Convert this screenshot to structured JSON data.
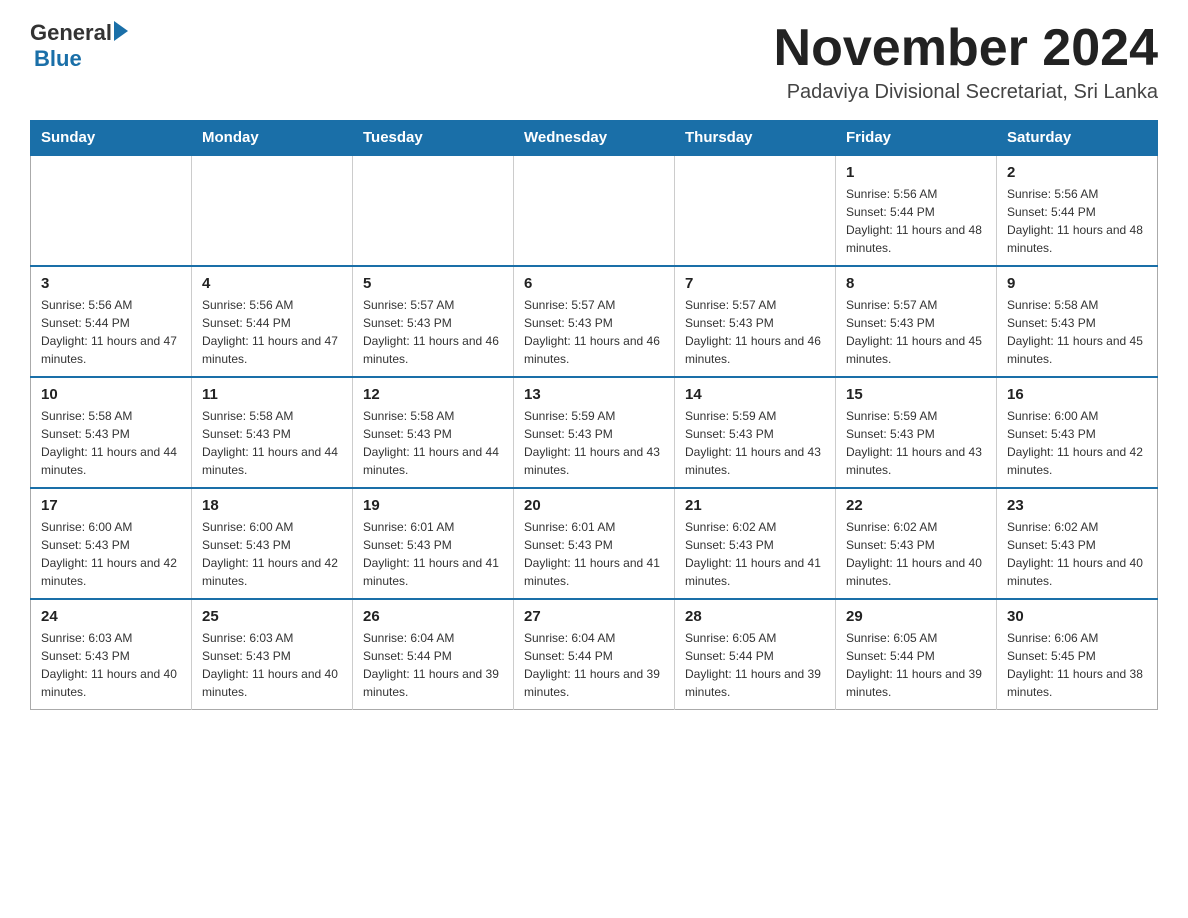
{
  "logo": {
    "general": "General",
    "arrow": "",
    "blue": "Blue"
  },
  "title": "November 2024",
  "subtitle": "Padaviya Divisional Secretariat, Sri Lanka",
  "days_of_week": [
    "Sunday",
    "Monday",
    "Tuesday",
    "Wednesday",
    "Thursday",
    "Friday",
    "Saturday"
  ],
  "weeks": [
    [
      {
        "day": "",
        "info": ""
      },
      {
        "day": "",
        "info": ""
      },
      {
        "day": "",
        "info": ""
      },
      {
        "day": "",
        "info": ""
      },
      {
        "day": "",
        "info": ""
      },
      {
        "day": "1",
        "info": "Sunrise: 5:56 AM\nSunset: 5:44 PM\nDaylight: 11 hours and 48 minutes."
      },
      {
        "day": "2",
        "info": "Sunrise: 5:56 AM\nSunset: 5:44 PM\nDaylight: 11 hours and 48 minutes."
      }
    ],
    [
      {
        "day": "3",
        "info": "Sunrise: 5:56 AM\nSunset: 5:44 PM\nDaylight: 11 hours and 47 minutes."
      },
      {
        "day": "4",
        "info": "Sunrise: 5:56 AM\nSunset: 5:44 PM\nDaylight: 11 hours and 47 minutes."
      },
      {
        "day": "5",
        "info": "Sunrise: 5:57 AM\nSunset: 5:43 PM\nDaylight: 11 hours and 46 minutes."
      },
      {
        "day": "6",
        "info": "Sunrise: 5:57 AM\nSunset: 5:43 PM\nDaylight: 11 hours and 46 minutes."
      },
      {
        "day": "7",
        "info": "Sunrise: 5:57 AM\nSunset: 5:43 PM\nDaylight: 11 hours and 46 minutes."
      },
      {
        "day": "8",
        "info": "Sunrise: 5:57 AM\nSunset: 5:43 PM\nDaylight: 11 hours and 45 minutes."
      },
      {
        "day": "9",
        "info": "Sunrise: 5:58 AM\nSunset: 5:43 PM\nDaylight: 11 hours and 45 minutes."
      }
    ],
    [
      {
        "day": "10",
        "info": "Sunrise: 5:58 AM\nSunset: 5:43 PM\nDaylight: 11 hours and 44 minutes."
      },
      {
        "day": "11",
        "info": "Sunrise: 5:58 AM\nSunset: 5:43 PM\nDaylight: 11 hours and 44 minutes."
      },
      {
        "day": "12",
        "info": "Sunrise: 5:58 AM\nSunset: 5:43 PM\nDaylight: 11 hours and 44 minutes."
      },
      {
        "day": "13",
        "info": "Sunrise: 5:59 AM\nSunset: 5:43 PM\nDaylight: 11 hours and 43 minutes."
      },
      {
        "day": "14",
        "info": "Sunrise: 5:59 AM\nSunset: 5:43 PM\nDaylight: 11 hours and 43 minutes."
      },
      {
        "day": "15",
        "info": "Sunrise: 5:59 AM\nSunset: 5:43 PM\nDaylight: 11 hours and 43 minutes."
      },
      {
        "day": "16",
        "info": "Sunrise: 6:00 AM\nSunset: 5:43 PM\nDaylight: 11 hours and 42 minutes."
      }
    ],
    [
      {
        "day": "17",
        "info": "Sunrise: 6:00 AM\nSunset: 5:43 PM\nDaylight: 11 hours and 42 minutes."
      },
      {
        "day": "18",
        "info": "Sunrise: 6:00 AM\nSunset: 5:43 PM\nDaylight: 11 hours and 42 minutes."
      },
      {
        "day": "19",
        "info": "Sunrise: 6:01 AM\nSunset: 5:43 PM\nDaylight: 11 hours and 41 minutes."
      },
      {
        "day": "20",
        "info": "Sunrise: 6:01 AM\nSunset: 5:43 PM\nDaylight: 11 hours and 41 minutes."
      },
      {
        "day": "21",
        "info": "Sunrise: 6:02 AM\nSunset: 5:43 PM\nDaylight: 11 hours and 41 minutes."
      },
      {
        "day": "22",
        "info": "Sunrise: 6:02 AM\nSunset: 5:43 PM\nDaylight: 11 hours and 40 minutes."
      },
      {
        "day": "23",
        "info": "Sunrise: 6:02 AM\nSunset: 5:43 PM\nDaylight: 11 hours and 40 minutes."
      }
    ],
    [
      {
        "day": "24",
        "info": "Sunrise: 6:03 AM\nSunset: 5:43 PM\nDaylight: 11 hours and 40 minutes."
      },
      {
        "day": "25",
        "info": "Sunrise: 6:03 AM\nSunset: 5:43 PM\nDaylight: 11 hours and 40 minutes."
      },
      {
        "day": "26",
        "info": "Sunrise: 6:04 AM\nSunset: 5:44 PM\nDaylight: 11 hours and 39 minutes."
      },
      {
        "day": "27",
        "info": "Sunrise: 6:04 AM\nSunset: 5:44 PM\nDaylight: 11 hours and 39 minutes."
      },
      {
        "day": "28",
        "info": "Sunrise: 6:05 AM\nSunset: 5:44 PM\nDaylight: 11 hours and 39 minutes."
      },
      {
        "day": "29",
        "info": "Sunrise: 6:05 AM\nSunset: 5:44 PM\nDaylight: 11 hours and 39 minutes."
      },
      {
        "day": "30",
        "info": "Sunrise: 6:06 AM\nSunset: 5:45 PM\nDaylight: 11 hours and 38 minutes."
      }
    ]
  ]
}
